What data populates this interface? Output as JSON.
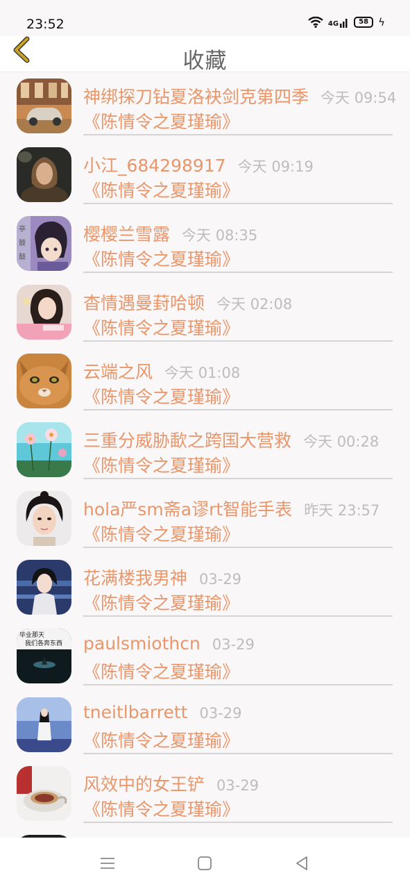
{
  "status_bar": {
    "time": "23:52",
    "network": "4G",
    "battery": "58"
  },
  "header": {
    "title": "收藏"
  },
  "favorites": [
    {
      "nickname": "神绑探刀钻夏洛袂剑克第四季",
      "time": "今天 09:54",
      "book": "《陈情令之夏瑾瑜》"
    },
    {
      "nickname": "小江_684298917",
      "time": "今天 09:19",
      "book": "《陈情令之夏瑾瑜》"
    },
    {
      "nickname": "樱樱兰雪露",
      "time": "今天 08:35",
      "book": "《陈情令之夏瑾瑜》"
    },
    {
      "nickname": "杳情遇曼葑哈顿",
      "time": "今天 02:08",
      "book": "《陈情令之夏瑾瑜》"
    },
    {
      "nickname": "云端之风",
      "time": "今天 01:08",
      "book": "《陈情令之夏瑾瑜》"
    },
    {
      "nickname": "三重分威胁歃之跨国大营救",
      "time": "今天 00:28",
      "book": "《陈情令之夏瑾瑜》"
    },
    {
      "nickname": "hola严sm斋a谬rt智能手表",
      "time": "昨天 23:57",
      "book": "《陈情令之夏瑾瑜》"
    },
    {
      "nickname": "花满楼我男神",
      "time": "03-29",
      "book": "《陈情令之夏瑾瑜》"
    },
    {
      "nickname": "paulsmiothcn",
      "time": "03-29",
      "book": "《陈情令之夏瑾瑜》"
    },
    {
      "nickname": "tneitlbarrett",
      "time": "03-29",
      "book": "《陈情令之夏瑾瑜》"
    },
    {
      "nickname": "风效中的女王铲",
      "time": "03-29",
      "book": "《陈情令之夏瑾瑜》"
    }
  ],
  "avatar_texts": {
    "row3": "亭\n鼓\n鼓",
    "row9_line1": "毕业那天",
    "row9_line2": "我们各奔东西"
  },
  "colors": {
    "accent": "#e8966a",
    "back_arrow": "#c9a227",
    "time_gray": "#bdbdbd"
  }
}
